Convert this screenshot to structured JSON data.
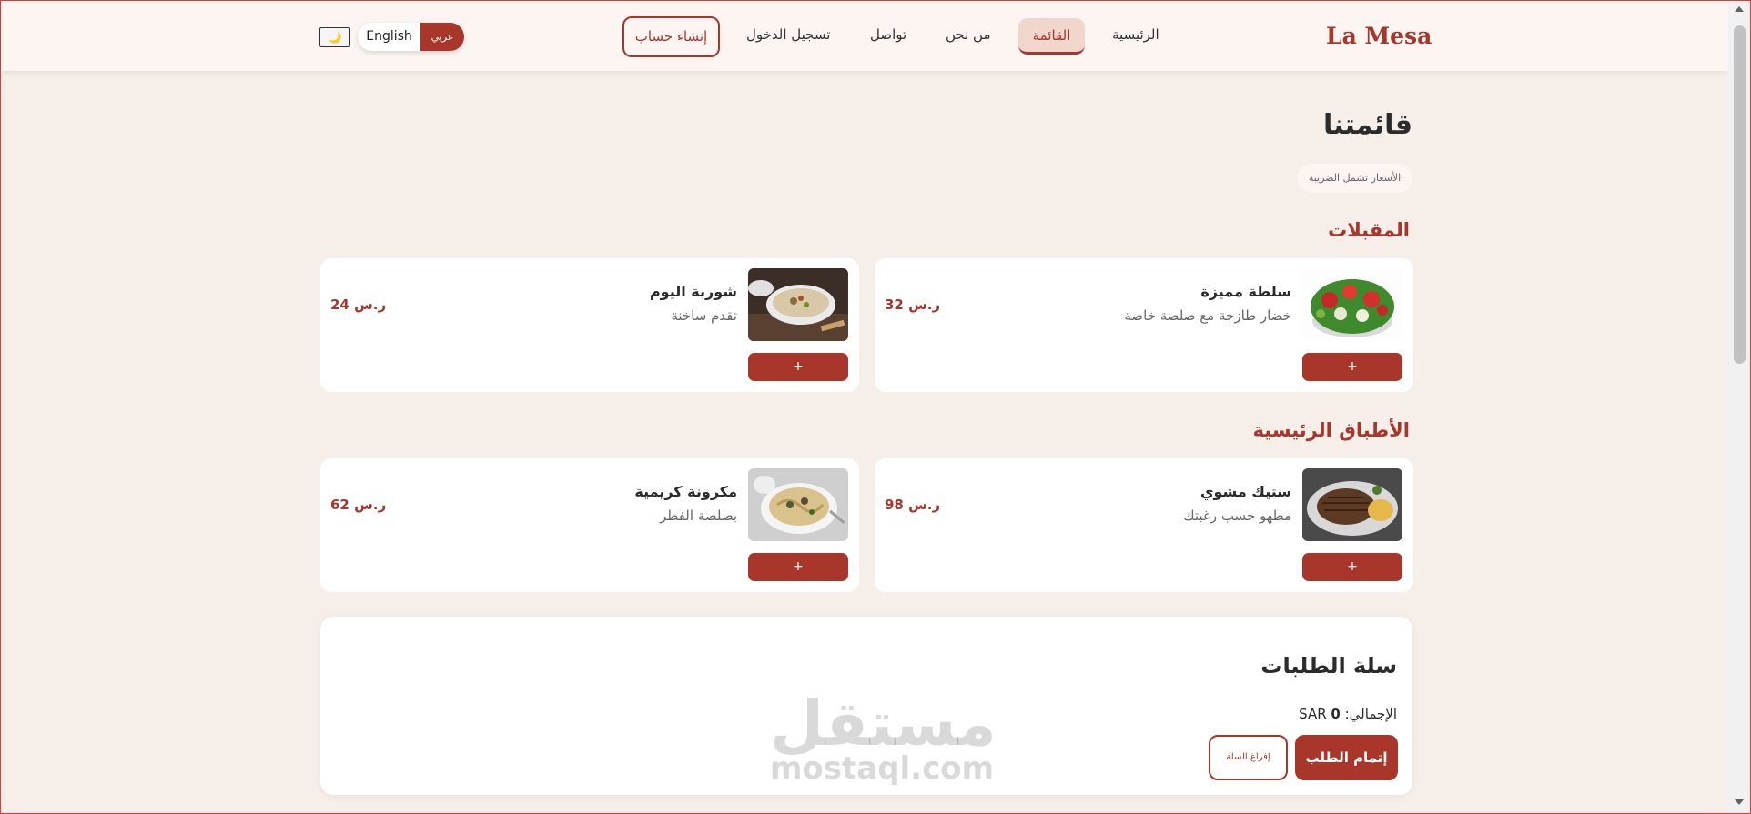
{
  "header": {
    "brand": "La Mesa",
    "nav": {
      "home": "الرئيسية",
      "menu": "القائمة",
      "about": "من نحن",
      "contact": "تواصل",
      "login": "تسجيل الدخول",
      "signup": "إنشاء حساب"
    },
    "lang": {
      "english": "English",
      "arabic": "عربي"
    },
    "theme_icon": "🌙"
  },
  "page": {
    "title": "قائمتنا",
    "tax_note": "الأسعار تشمل الضريبة"
  },
  "sections": [
    {
      "title": "المقبلات",
      "items": [
        {
          "name": "سلطة مميزة",
          "desc": "خضار طازجة مع صلصة خاصة",
          "price": "32 ر.س",
          "add": "+",
          "image": "salad-image"
        },
        {
          "name": "شوربة اليوم",
          "desc": "تقدم ساخنة",
          "price": "24 ر.س",
          "add": "+",
          "image": "soup-image"
        }
      ]
    },
    {
      "title": "الأطباق الرئيسية",
      "items": [
        {
          "name": "ستيك مشوي",
          "desc": "مطهو حسب رغبتك",
          "price": "98 ر.س",
          "add": "+",
          "image": "steak-image"
        },
        {
          "name": "مكرونة كريمية",
          "desc": "بصلصة الفطر",
          "price": "62 ر.س",
          "add": "+",
          "image": "pasta-image"
        }
      ]
    }
  ],
  "cart": {
    "title": "سلة الطلبات",
    "total_label": "الإجمالي:",
    "total_value": "0",
    "currency": "SAR",
    "checkout": "إتمام الطلب",
    "empty": "إفراغ السلة"
  },
  "watermark": {
    "arabic": "مستقل",
    "latin": "mostaql.com"
  },
  "colors": {
    "accent": "#a8362b",
    "background": "#f6eee8",
    "card": "#ffffff"
  }
}
